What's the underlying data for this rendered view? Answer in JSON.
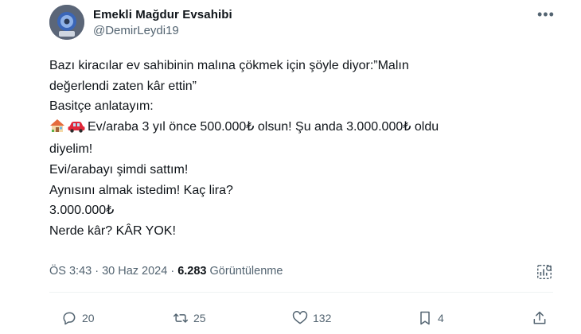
{
  "author": {
    "display_name": "Emekli Mağdur Evsahibi",
    "handle": "@DemirLeydi19",
    "avatar_icon": "avatar-icon"
  },
  "menu": {
    "more_label": "•••"
  },
  "tweet": {
    "lines": [
      "Bazı kiracılar ev sahibinin malına çökmek için şöyle diyor:”Malın",
      "değerlendi zaten kâr ettin”",
      "Basitçe anlatayım:",
      "Ev/araba 3 yıl önce 500.000₺ olsun! Şu anda 3.000.000₺ oldu",
      "diyelim!",
      "Evi/arabayı şimdi sattım!",
      "Aynısını almak istedim! Kaç lira?",
      "3.000.000₺",
      "Nerde kâr? KÂR YOK!"
    ],
    "line4_emojis": [
      "house-emoji",
      "car-emoji"
    ]
  },
  "meta": {
    "time_date": "ÖS 3:43 · 30 Haz 2024 · ",
    "views_count": "6.283",
    "views_label": " Görüntülenme"
  },
  "actions": {
    "replies": "20",
    "reposts": "25",
    "likes": "132",
    "bookmarks": "4"
  },
  "colors": {
    "text": "#0f1419",
    "secondary": "#536471",
    "divider": "#eff3f4",
    "car": "#e0283a"
  }
}
